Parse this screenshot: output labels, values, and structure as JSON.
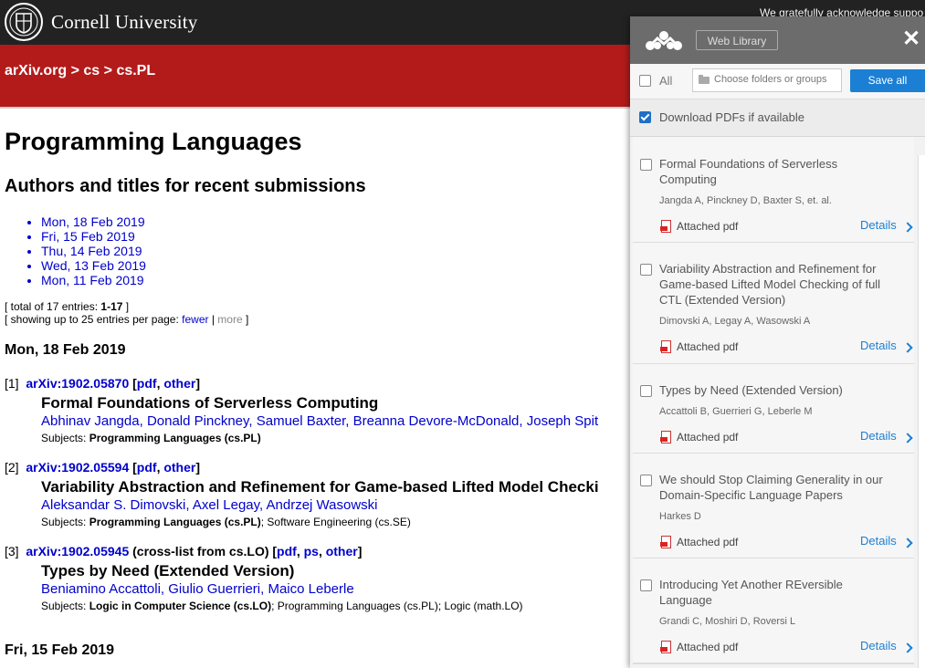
{
  "header": {
    "university": "Cornell University",
    "acknowledgement": "We gratefully acknowledge suppo",
    "breadcrumb": {
      "site": "arXiv.org",
      "sep1": " > ",
      "cat": "cs",
      "sep2": " > ",
      "sub": "cs.PL"
    }
  },
  "page": {
    "title": "Programming Languages",
    "subtitle": "Authors and titles for recent submissions",
    "dates": [
      "Mon, 18 Feb 2019",
      "Fri, 15 Feb 2019",
      "Thu, 14 Feb 2019",
      "Wed, 13 Feb 2019",
      "Mon, 11 Feb 2019"
    ],
    "totals": {
      "line1_prefix": "[ total of 17 entries: ",
      "line1_range": "1-17",
      "line1_suffix": " ]",
      "line2_prefix": "[ showing up to 25 entries per page: ",
      "fewer": "fewer",
      "sep": " | ",
      "more": "more",
      "line2_suffix": " ]"
    },
    "day1": "Mon, 18 Feb 2019",
    "day2": "Fri, 15 Feb 2019",
    "entries": [
      {
        "num": "[1]",
        "id": "arXiv:1902.05870",
        "pre": " [",
        "cross": "",
        "links": [
          "pdf",
          "other"
        ],
        "title": "Formal Foundations of Serverless Computing",
        "authors": [
          "Abhinav Jangda",
          "Donald Pinckney",
          "Samuel Baxter",
          "Breanna Devore-McDonald",
          "Joseph Spit"
        ],
        "subj_label": "Subjects: ",
        "subj_main": "Programming Languages (cs.PL)",
        "subj_rest": ""
      },
      {
        "num": "[2]",
        "id": "arXiv:1902.05594",
        "pre": " [",
        "cross": "",
        "links": [
          "pdf",
          "other"
        ],
        "title": "Variability Abstraction and Refinement for Game-based Lifted Model Checki",
        "authors": [
          "Aleksandar S. Dimovski",
          "Axel Legay",
          "Andrzej Wasowski"
        ],
        "subj_label": "Subjects: ",
        "subj_main": "Programming Languages (cs.PL)",
        "subj_rest": "; Software Engineering (cs.SE)"
      },
      {
        "num": "[3]",
        "id": "arXiv:1902.05945",
        "pre": " ",
        "cross": "(cross-list from cs.LO) [",
        "links": [
          "pdf",
          "ps",
          "other"
        ],
        "title": "Types by Need (Extended Version)",
        "authors": [
          "Beniamino Accattoli",
          "Giulio Guerrieri",
          "Maico Leberle"
        ],
        "subj_label": "Subjects: ",
        "subj_main": "Logic in Computer Science (cs.LO)",
        "subj_rest": "; Programming Languages (cs.PL); Logic (math.LO)"
      }
    ]
  },
  "panel": {
    "library_button": "Web Library",
    "close_glyph": "✕",
    "all_label": "All",
    "all_checked": false,
    "folders_placeholder": "Choose folders or groups",
    "save_all": "Save all",
    "download_label": "Download PDFs if available",
    "download_checked": true,
    "items": [
      {
        "title": "Formal Foundations of Serverless Computing",
        "authors": "Jangda A,   Pinckney D,   Baxter S,   et. al.",
        "attachment": "Attached pdf",
        "details": "Details"
      },
      {
        "title": "Variability Abstraction and Refinement for Game-based Lifted Model Checking of full CTL (Extended Version)",
        "authors": "Dimovski A,   Legay A,   Wasowski A",
        "attachment": "Attached pdf",
        "details": "Details"
      },
      {
        "title": "Types by Need (Extended Version)",
        "authors": "Accattoli B,   Guerrieri G,   Leberle M",
        "attachment": "Attached pdf",
        "details": "Details"
      },
      {
        "title": "We should Stop Claiming Generality in our Domain-Specific Language Papers",
        "authors": "Harkes D",
        "attachment": "Attached pdf",
        "details": "Details"
      },
      {
        "title": "Introducing Yet Another REversible Language",
        "authors": "Grandi C,   Moshiri D,   Roversi L",
        "attachment": "Attached pdf",
        "details": "Details"
      }
    ]
  }
}
